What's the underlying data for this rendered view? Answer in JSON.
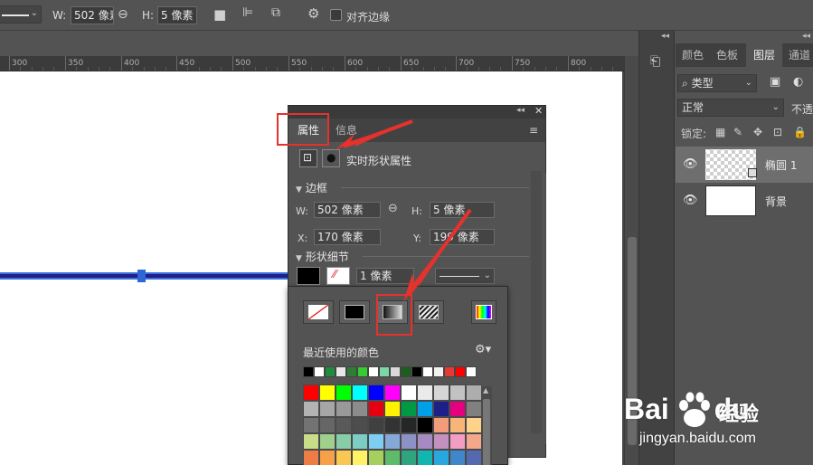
{
  "options_bar": {
    "w_label": "W:",
    "w_value": "502 像素",
    "h_label": "H:",
    "h_value": "5 像素",
    "align_edges_label": "对齐边缘"
  },
  "ruler": {
    "ticks": [
      "300",
      "350",
      "400",
      "450",
      "500",
      "550",
      "600",
      "650",
      "700",
      "750",
      "800",
      "85"
    ]
  },
  "layers_panel": {
    "tabs": [
      "颜色",
      "色板",
      "图层",
      "通道"
    ],
    "active_tab": "图层",
    "filter_type": "类型",
    "blend_mode": "正常",
    "opacity_label_partial": "不透",
    "lock_label": "锁定:",
    "layers": [
      {
        "name": "椭圆 1",
        "selected": true
      },
      {
        "name": "背景",
        "selected": false
      }
    ]
  },
  "properties_panel": {
    "tabs": [
      "属性",
      "信息"
    ],
    "active_tab": "属性",
    "live_shape_title": "实时形状属性",
    "bounds_section": "边框",
    "w_label": "W:",
    "w_value": "502 像素",
    "h_label": "H:",
    "h_value": "5 像素",
    "x_label": "X:",
    "x_value": "170 像素",
    "y_label": "Y:",
    "y_value": "199 像素",
    "shape_details_section": "形状细节",
    "stroke_width": "1 像素"
  },
  "color_dropdown": {
    "fill_types": [
      "none",
      "solid",
      "gradient",
      "pattern",
      "picker"
    ],
    "selected_fill_type": "gradient",
    "recent_colors_label": "最近使用的颜色",
    "recent_colors": [
      "#000000",
      "#ffffff",
      "#1e8c3c",
      "#e8e8e8",
      "#2e7d32",
      "#33cc33",
      "#ffffff",
      "#7ed6a8",
      "#d9d9d9",
      "#1b5e20",
      "#000000",
      "#ffffff",
      "#f2f2f2",
      "#e53935",
      "#ff0000",
      "#ffffff"
    ],
    "swatches": [
      "#ff0000",
      "#ffff00",
      "#00ff00",
      "#00ffff",
      "#0000ff",
      "#ff00ff",
      "#ffffff",
      "#ebebeb",
      "#d6d6d6",
      "#c2c2c2",
      "#adadad",
      "#b3b3b3",
      "#a6a6a6",
      "#999999",
      "#8c8c8c",
      "#e60012",
      "#fff100",
      "#009944",
      "#00a0e9",
      "#1d2088",
      "#e4007f",
      "#808080",
      "#737373",
      "#666666",
      "#595959",
      "#4d4d4d",
      "#404040",
      "#333333",
      "#262626",
      "#000000",
      "#f29c7b",
      "#f8b57a",
      "#fdd28a",
      "#c9dc87",
      "#9fd18c",
      "#89cca8",
      "#7dcdc5",
      "#7ecef4",
      "#85a8d6",
      "#8d92c6",
      "#a58bc1",
      "#c490bf",
      "#f19ec2",
      "#f5a78b",
      "#ee7d45",
      "#f6a14a",
      "#fbc753",
      "#fff267",
      "#a7cf5d",
      "#5ebb6a",
      "#2ea57f",
      "#13b5b1",
      "#29a8e0",
      "#3f87c8",
      "#5569b0"
    ]
  },
  "watermark": {
    "brand_latin": "Bai",
    "brand_latin2": "du",
    "brand_cn": "经验",
    "url": "jingyan.baidu.com"
  }
}
